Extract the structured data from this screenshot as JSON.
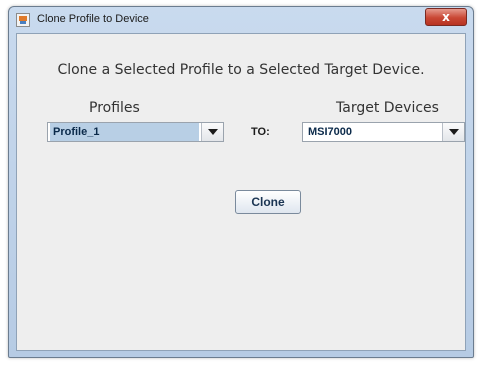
{
  "window": {
    "title": "Clone Profile to Device",
    "close_label": "x",
    "icons": {
      "app": "java-app-icon",
      "close": "close-icon",
      "dropdown": "chevron-down-icon"
    }
  },
  "dialog": {
    "heading": "Clone a Selected Profile to a Selected Target Device.",
    "profiles_label": "Profiles",
    "profiles_selected": "Profile_1",
    "to_label": "TO:",
    "target_label": "Target Devices",
    "target_selected": "MSI7000",
    "clone_button": "Clone"
  },
  "colors": {
    "title_bar": "#c9daee",
    "panel": "#eeeeee",
    "selection": "#b8cfe5",
    "close_button": "#c94734"
  }
}
